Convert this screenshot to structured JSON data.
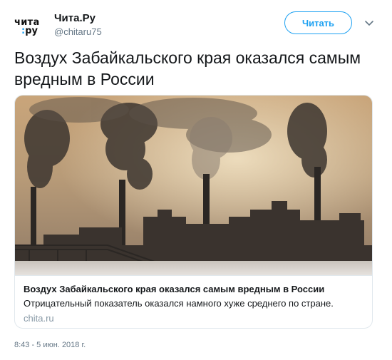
{
  "header": {
    "avatar_line1": "чита",
    "avatar_line2_colon": ":",
    "avatar_line2_rest": "ру",
    "display_name": "Чита.Ру",
    "handle": "@chitaru75",
    "follow_label": "Читать",
    "caret_icon": "chevron-down-icon"
  },
  "tweet": {
    "text": "Воздух Забайкальского края оказался самым вредным в России"
  },
  "card": {
    "image_icon": "industrial-smokestacks-photo",
    "title": "Воздух Забайкальского края оказался самым вредным в России",
    "description": "Отрицательный показатель оказался намного хуже среднего по стране.",
    "domain": "chita.ru"
  },
  "footer": {
    "timestamp": "8:43 - 5 июн. 2018 г."
  },
  "colors": {
    "accent": "#1da1f2",
    "text": "#14171a",
    "muted": "#657786"
  }
}
